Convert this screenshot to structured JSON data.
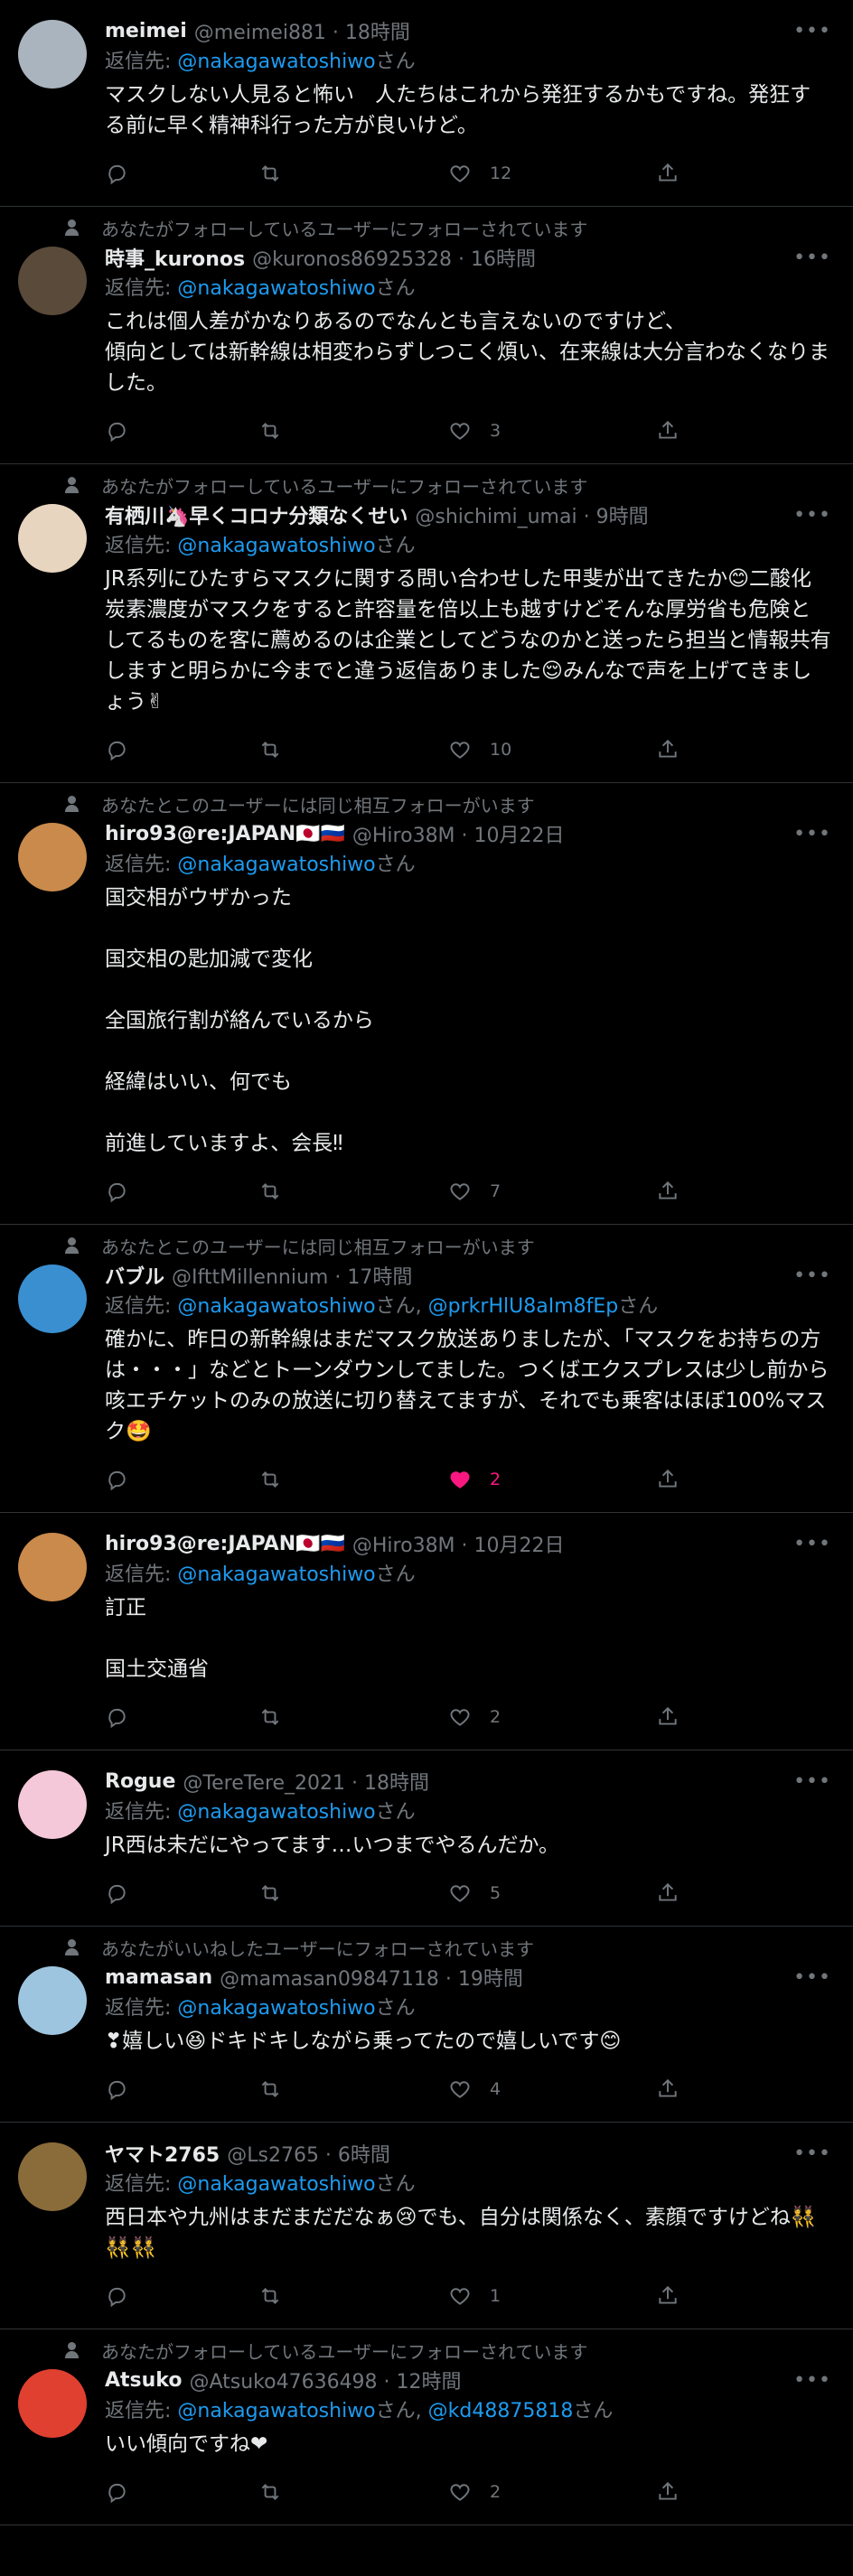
{
  "reply_prefix": "返信先: ",
  "reply_suffix": "さん",
  "tweets": [
    {
      "context": "",
      "name": "meimei",
      "handle": "@meimei881 · 18時間",
      "mentions": [
        "@nakagawatoshiwo"
      ],
      "body": "マスクしない人見ると怖い　人たちはこれから発狂するかもですね。発狂する前に早く精神科行った方が良いけど。",
      "likes": "12",
      "liked": false
    },
    {
      "context": "あなたがフォローしているユーザーにフォローされています",
      "name": "時事_kuronos",
      "handle": "@kuronos86925328 · 16時間",
      "mentions": [
        "@nakagawatoshiwo"
      ],
      "body": "これは個人差がかなりあるのでなんとも言えないのですけど、\n傾向としては新幹線は相変わらずしつこく煩い、在来線は大分言わなくなりました。",
      "likes": "3",
      "liked": false
    },
    {
      "context": "あなたがフォローしているユーザーにフォローされています",
      "name": "有栖川🦄早くコロナ分類なくせい",
      "handle": "@shichimi_umai · 9時間",
      "mentions": [
        "@nakagawatoshiwo"
      ],
      "body": "JR系列にひたすらマスクに関する問い合わせした甲斐が出てきたか😊二酸化炭素濃度がマスクをすると許容量を倍以上も越すけどそんな厚労省も危険としてるものを客に薦めるのは企業としてどうなのかと送ったら担当と情報共有しますと明らかに今までと違う返信ありました😌みんなで声を上げてきましょう✌",
      "likes": "10",
      "liked": false
    },
    {
      "context": "あなたとこのユーザーには同じ相互フォローがいます",
      "name": "hiro93@re:JAPAN🇯🇵🇷🇺",
      "handle": "@Hiro38M · 10月22日",
      "mentions": [
        "@nakagawatoshiwo"
      ],
      "body": "国交相がウザかった\n\n国交相の匙加減で変化\n\n全国旅行割が絡んでいるから\n\n経緯はいい、何でも\n\n前進していますよ、会長‼",
      "likes": "7",
      "liked": false
    },
    {
      "context": "あなたとこのユーザーには同じ相互フォローがいます",
      "name": "バブル",
      "handle": "@IfttMillennium · 17時間",
      "mentions": [
        "@nakagawatoshiwo",
        "@prkrHlU8aIm8fEp"
      ],
      "body": "確かに、昨日の新幹線はまだマスク放送ありましたが、「マスクをお持ちの方は・・・」などとトーンダウンしてました。つくばエクスプレスは少し前から咳エチケットのみの放送に切り替えてますが、それでも乗客はほぼ100%マスク🤩",
      "likes": "2",
      "liked": true
    },
    {
      "context": "",
      "name": "hiro93@re:JAPAN🇯🇵🇷🇺",
      "handle": "@Hiro38M · 10月22日",
      "mentions": [
        "@nakagawatoshiwo"
      ],
      "body": "訂正\n\n国土交通省",
      "likes": "2",
      "liked": false
    },
    {
      "context": "",
      "name": "Rogue",
      "handle": "@TereTere_2021 · 18時間",
      "mentions": [
        "@nakagawatoshiwo"
      ],
      "body": "JR西は未だにやってます…いつまでやるんだか。",
      "likes": "5",
      "liked": false
    },
    {
      "context": "あなたがいいねしたユーザーにフォローされています",
      "name": "mamasan",
      "handle": "@mamasan09847118 · 19時間",
      "mentions": [
        "@nakagawatoshiwo"
      ],
      "body": "❣嬉しい😆ドキドキしながら乗ってたので嬉しいです😊",
      "likes": "4",
      "liked": false
    },
    {
      "context": "",
      "name": "ヤマト2765",
      "handle": "@Ls2765 · 6時間",
      "mentions": [
        "@nakagawatoshiwo"
      ],
      "body": "西日本や九州はまだまだだなぁ😢でも、自分は関係なく、素顔ですけどね👯👯👯",
      "likes": "1",
      "liked": false
    },
    {
      "context": "あなたがフォローしているユーザーにフォローされています",
      "name": "Atsuko",
      "handle": "@Atsuko47636498 · 12時間",
      "mentions": [
        "@nakagawatoshiwo",
        "@kd48875818"
      ],
      "body": "いい傾向ですね❤",
      "likes": "2",
      "liked": false
    }
  ],
  "avatar_colors": [
    "#aab4be",
    "#5a4a3a",
    "#e8d5c0",
    "#c98a4b",
    "#3a8fd0",
    "#c98a4b",
    "#f4c8d8",
    "#9ec5e0",
    "#8a6b3a",
    "#e04030"
  ]
}
